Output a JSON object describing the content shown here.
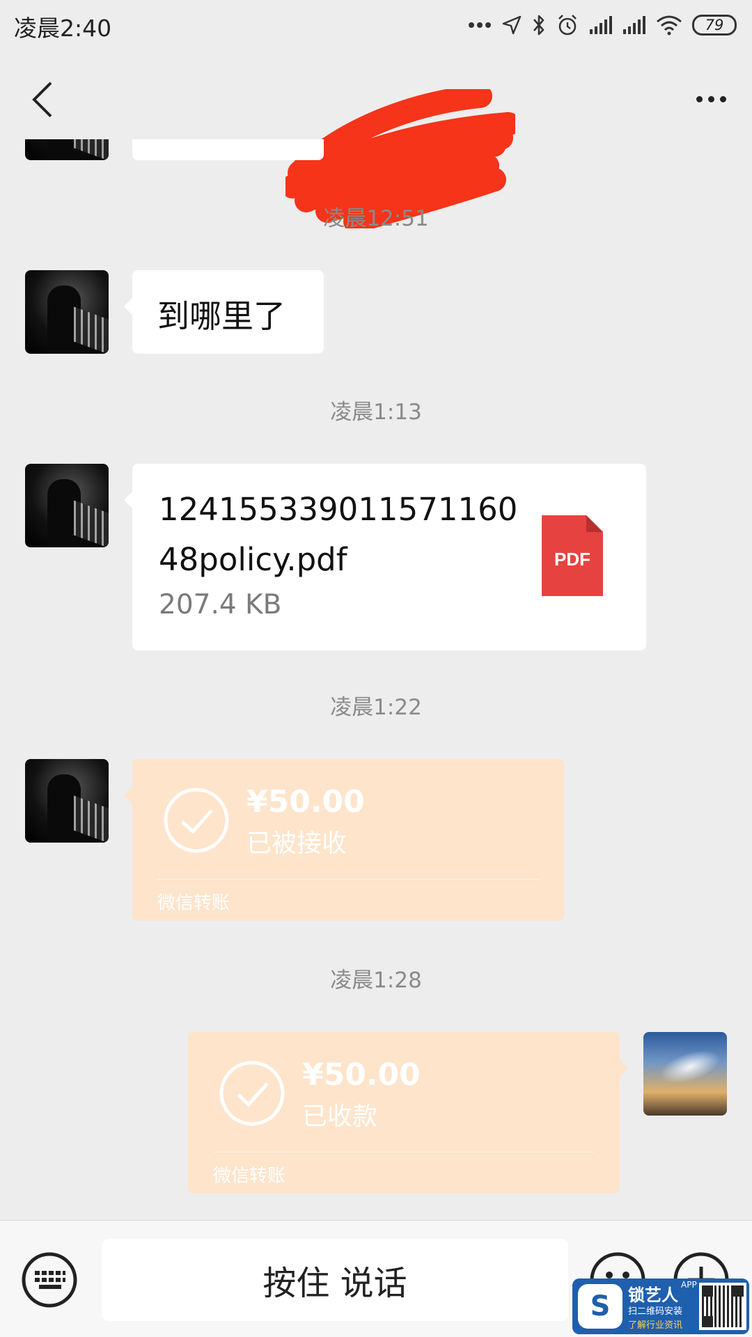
{
  "status_bar": {
    "time": "凌晨2:40",
    "battery": "79"
  },
  "header": {
    "contact_name": ""
  },
  "chat": {
    "messages": [
      {
        "timestamp": "凌晨12:51",
        "sender": "contact",
        "type": "text",
        "text": "到哪里了"
      },
      {
        "timestamp": "凌晨1:13",
        "sender": "contact",
        "type": "file",
        "file_name": "124155339011571160 48policy.pdf",
        "file_size": "207.4 KB",
        "file_icon_label": "PDF",
        "file_icon_color": "#e64340"
      },
      {
        "timestamp": "凌晨1:22",
        "sender": "contact",
        "type": "transfer",
        "amount": "¥50.00",
        "status": "已被接收",
        "brand": "微信转账"
      },
      {
        "timestamp": "凌晨1:28",
        "sender": "self",
        "type": "transfer",
        "amount": "¥50.00",
        "status": "已收款",
        "brand": "微信转账"
      }
    ]
  },
  "input_bar": {
    "hold_to_talk": "按住 说话"
  },
  "watermark": {
    "name": "锁艺人",
    "app": "APP",
    "line1": "扫二维码安装",
    "line2": "了解行业资讯"
  },
  "colors": {
    "background": "#ededed",
    "bubble": "#ffffff",
    "transfer_bubble": "#fde4cb",
    "redaction": "#f5341a"
  }
}
